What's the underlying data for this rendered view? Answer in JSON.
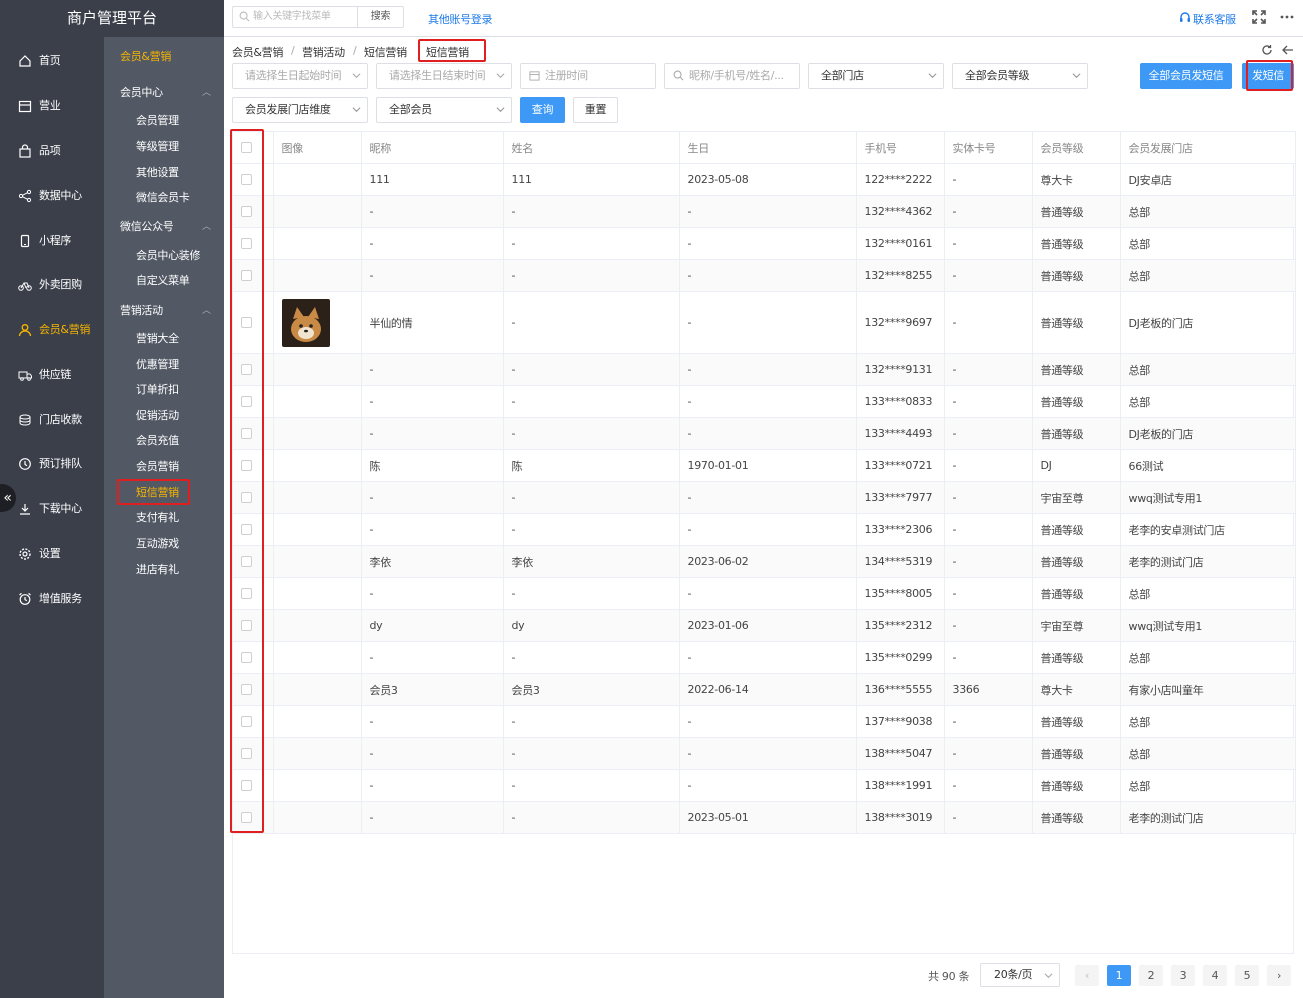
{
  "app": {
    "title": "商户管理平台"
  },
  "nav": {
    "items": [
      {
        "label": "首页",
        "icon": "home-icon"
      },
      {
        "label": "营业",
        "icon": "calendar-icon"
      },
      {
        "label": "品项",
        "icon": "bag-icon"
      },
      {
        "label": "数据中心",
        "icon": "share-icon"
      },
      {
        "label": "小程序",
        "icon": "phone-icon"
      },
      {
        "label": "外卖团购",
        "icon": "bike-icon"
      },
      {
        "label": "会员&营销",
        "icon": "user-icon"
      },
      {
        "label": "供应链",
        "icon": "truck-icon"
      },
      {
        "label": "门店收款",
        "icon": "coins-icon"
      },
      {
        "label": "预订排队",
        "icon": "clock-icon"
      },
      {
        "label": "下载中心",
        "icon": "download-icon"
      },
      {
        "label": "设置",
        "icon": "gear-icon"
      },
      {
        "label": "增值服务",
        "icon": "alarm-icon"
      }
    ],
    "active": "会员&营销"
  },
  "subnav": {
    "top": "会员&营销",
    "groups": [
      {
        "label": "会员中心",
        "items": [
          "会员管理",
          "等级管理",
          "其他设置",
          "微信会员卡"
        ]
      },
      {
        "label": "微信公众号",
        "items": [
          "会员中心装修",
          "自定义菜单"
        ]
      },
      {
        "label": "营销活动",
        "items": [
          "营销大全",
          "优惠管理",
          "订单折扣",
          "促销活动",
          "会员充值",
          "会员营销",
          "短信营销",
          "支付有礼",
          "互动游戏",
          "进店有礼"
        ]
      }
    ],
    "active": "短信营销"
  },
  "topbar": {
    "search_placeholder": "输入关键字找菜单",
    "search_button": "搜索",
    "other_login": "其他账号登录",
    "contact": "联系客服"
  },
  "breadcrumb": [
    "会员&营销",
    "营销活动",
    "短信营销",
    "短信营销"
  ],
  "filters": {
    "birthday_start": "请选择生日起始时间",
    "birthday_end": "请选择生日结束时间",
    "register_time": "注册时间",
    "keyword": "昵称/手机号/姓名/...",
    "store": "全部门店",
    "level": "全部会员等级",
    "dimension": "会员发展门店维度",
    "member_type": "全部会员",
    "query": "查询",
    "reset": "重置",
    "send_all": "全部会员发短信",
    "send": "发短信"
  },
  "table": {
    "columns": [
      "",
      "图像",
      "昵称",
      "姓名",
      "生日",
      "手机号",
      "实体卡号",
      "会员等级",
      "会员发展门店"
    ],
    "rows": [
      [
        "111",
        "111",
        "2023-05-08",
        "122****2222",
        "-",
        "尊大卡",
        "DJ安卓店"
      ],
      [
        "-",
        "-",
        "-",
        "132****4362",
        "-",
        "普通等级",
        "总部"
      ],
      [
        "-",
        "-",
        "-",
        "132****0161",
        "-",
        "普通等级",
        "总部"
      ],
      [
        "-",
        "-",
        "-",
        "132****8255",
        "-",
        "普通等级",
        "总部"
      ],
      [
        "半仙的情",
        "-",
        "-",
        "132****9697",
        "-",
        "普通等级",
        "DJ老板的门店"
      ],
      [
        "-",
        "-",
        "-",
        "132****9131",
        "-",
        "普通等级",
        "总部"
      ],
      [
        "-",
        "-",
        "-",
        "133****0833",
        "-",
        "普通等级",
        "总部"
      ],
      [
        "-",
        "-",
        "-",
        "133****4493",
        "-",
        "普通等级",
        "DJ老板的门店"
      ],
      [
        "陈",
        "陈",
        "1970-01-01",
        "133****0721",
        "-",
        "DJ",
        "66测试"
      ],
      [
        "-",
        "-",
        "-",
        "133****7977",
        "-",
        "宇宙至尊",
        "wwq测试专用1"
      ],
      [
        "-",
        "-",
        "-",
        "133****2306",
        "-",
        "普通等级",
        "老李的安卓测试门店"
      ],
      [
        "李依",
        "李依",
        "2023-06-02",
        "134****5319",
        "-",
        "普通等级",
        "老李的测试门店"
      ],
      [
        "-",
        "-",
        "-",
        "135****8005",
        "-",
        "普通等级",
        "总部"
      ],
      [
        "dy",
        "dy",
        "2023-01-06",
        "135****2312",
        "-",
        "宇宙至尊",
        "wwq测试专用1"
      ],
      [
        "-",
        "-",
        "-",
        "135****0299",
        "-",
        "普通等级",
        "总部"
      ],
      [
        "会员3",
        "会员3",
        "2022-06-14",
        "136****5555",
        "3366",
        "尊大卡",
        "有家小店叫童年"
      ],
      [
        "-",
        "-",
        "-",
        "137****9038",
        "-",
        "普通等级",
        "总部"
      ],
      [
        "-",
        "-",
        "-",
        "138****5047",
        "-",
        "普通等级",
        "总部"
      ],
      [
        "-",
        "-",
        "-",
        "138****1991",
        "-",
        "普通等级",
        "总部"
      ],
      [
        "-",
        "-",
        "2023-05-01",
        "138****3019",
        "-",
        "普通等级",
        "老李的测试门店"
      ]
    ],
    "avatar_row": 4
  },
  "pagination": {
    "total": "共 90 条",
    "page_size": "20条/页",
    "pages": [
      "1",
      "2",
      "3",
      "4",
      "5"
    ],
    "current": "1"
  }
}
